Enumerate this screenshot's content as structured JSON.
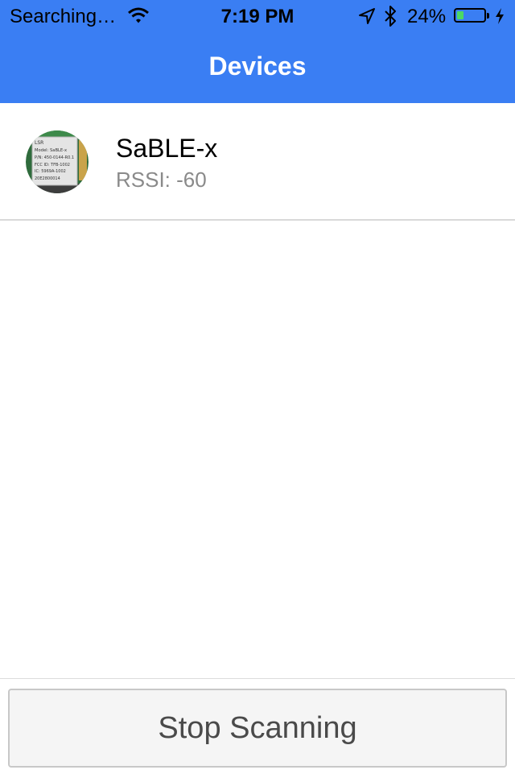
{
  "status_bar": {
    "carrier": "Searching…",
    "time": "7:19 PM",
    "battery_text": "24%",
    "battery_level": 0.24,
    "icons": [
      "wifi-icon",
      "location-arrow-icon",
      "bluetooth-icon",
      "battery-icon",
      "charging-bolt-icon"
    ]
  },
  "nav": {
    "title": "Devices"
  },
  "devices": [
    {
      "name": "SaBLE-x",
      "rssi": "RSSI: -60",
      "thumb_label": {
        "l1": "LSR",
        "l2": "Model: SaBLE-x",
        "l3": "P/N: 450-0144-R0.1",
        "l4": "FCC ID: TFB-1002",
        "l5": "IC: 5969A-1002",
        "l6": "20E2800014"
      }
    }
  ],
  "scan_button": {
    "label": "Stop Scanning"
  },
  "colors": {
    "nav_bar": "#3a7ef3",
    "battery_fill": "#4cd964",
    "rssi_text": "#8a8a8a"
  }
}
